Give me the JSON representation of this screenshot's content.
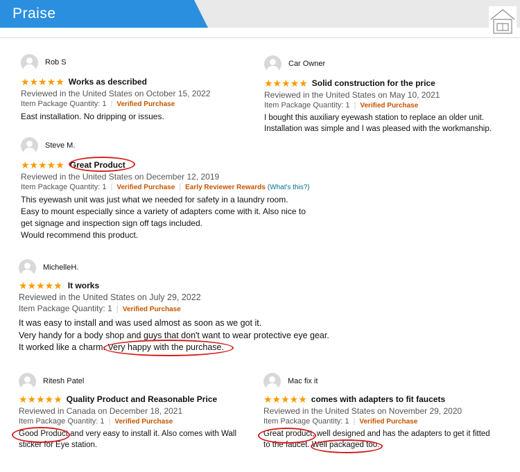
{
  "header": {
    "title": "Praise"
  },
  "reviews": [
    {
      "name": "Rob S",
      "title": "Works as described",
      "reviewed": "Reviewed in the United States on October 15, 2022",
      "qty": "Item Package Quantity: 1",
      "verified": "Verified Purchase",
      "body": [
        "East installation. No dripping or issues."
      ]
    },
    {
      "name": "Car Owner",
      "title": "Solid construction for the price",
      "reviewed": "Reviewed in the United States on May 10, 2021",
      "qty": "Item Package Quantity: 1",
      "verified": "Verified Purchase",
      "body": [
        "I bought this auxiliary eyewash station to replace an older unit.",
        "Installation was simple and I was pleased with the workmanship."
      ]
    },
    {
      "name": "Steve M.",
      "title": "Great Product",
      "reviewed": "Reviewed in the United States on December 12, 2019",
      "qty": "Item Package Quantity: 1",
      "verified": "Verified Purchase",
      "early": "Early Reviewer Rewards",
      "whats": "(What's this?)",
      "body": [
        "This eyewash unit was just what we needed for safety in a laundry room.",
        "Easy to mount especially since a variety of adapters come with it. Also nice to",
        "get signage and inspection sign off tags included.",
        "Would recommend this product."
      ]
    },
    {
      "name": "MichelleH.",
      "title": "It works",
      "reviewed": "Reviewed in the United States on July 29, 2022",
      "qty": "Item Package Quantity: 1",
      "verified": "Verified Purchase",
      "body": [
        "It was easy to install and was used almost as soon as we got it.",
        "Very handy for a body shop and guys that don't want to wear protective eye gear.",
        "It worked like a charm. Very happy with the purchase."
      ]
    },
    {
      "name": "Ritesh Patel",
      "title": "Quality Product and Reasonable Price",
      "reviewed": "Reviewed in Canada on December 18, 2021",
      "qty": "Item Package Quantity: 1",
      "verified": "Verified Purchase",
      "body": [
        "Good Product and very easy to install it. Also comes with Wall",
        "sticker for Eye station."
      ]
    },
    {
      "name": "Mac fix it",
      "title": "comes with adapters to fit faucets",
      "reviewed": "Reviewed in the United States on November 29, 2020",
      "qty": "Item Package Quantity: 1",
      "verified": "Verified Purchase",
      "body": [
        "Great product, well designed and has the adapters to get it fitted",
        "to the faucet. Well packaged too."
      ]
    }
  ],
  "stars": "★★★★★",
  "colors": {
    "accent": "#2b8fe0",
    "star": "#ff9900",
    "verified": "#c45500",
    "highlight": "#d41f1f"
  }
}
